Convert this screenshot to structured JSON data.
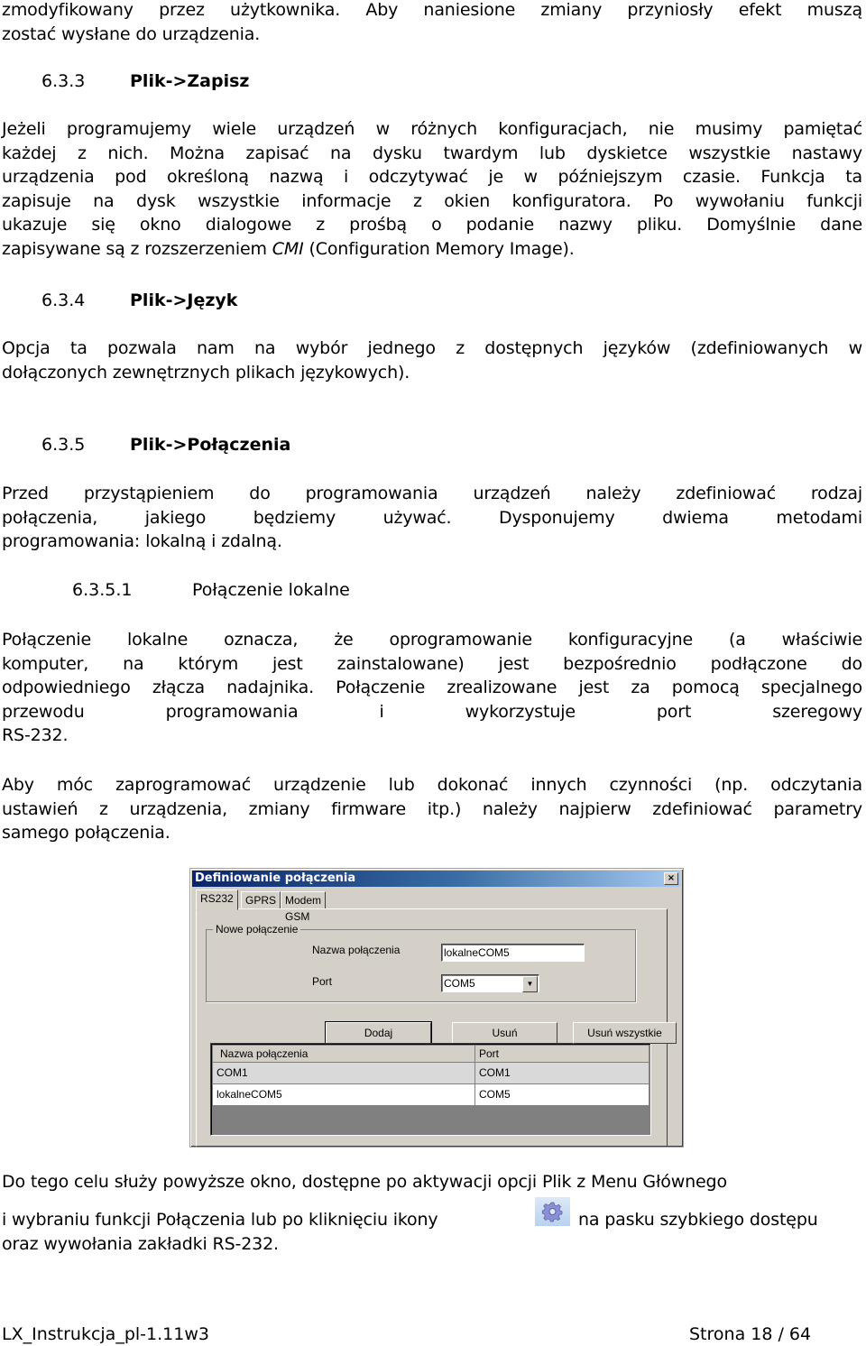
{
  "intro": {
    "lines": [
      "zmodyfikowany przez użytkownika. Aby naniesione zmiany przyniosły efekt muszą",
      "zostać wysłane do urządzenia."
    ]
  },
  "section_633": {
    "number": "6.3.3",
    "title": "Plik->Zapisz",
    "paragraph": [
      "Jeżeli programujemy wiele urządzeń w różnych konfiguracjach, nie musimy pamiętać",
      "każdej z nich. Można zapisać na dysku twardym lub dyskietce wszystkie nastawy",
      "urządzenia pod określoną nazwą i odczytywać je w późniejszym czasie. Funkcja ta",
      "zapisuje na dysk wszystkie informacje z okien konfiguratora. Po wywołaniu funkcji",
      "ukazuje się okno dialogowe z prośbą o podanie nazwy pliku.  Domyślnie dane"
    ],
    "last_line_before": "zapisywane są  z rozszerzeniem ",
    "last_line_italic": "CMI",
    "last_line_after": " (Configuration Memory Image)."
  },
  "section_634": {
    "number": "6.3.4",
    "title": "Plik->Język",
    "paragraph": [
      "Opcja ta pozwala nam na wybór jednego z dostępnych języków (zdefiniowanych w",
      "dołączonych zewnętrznych plikach językowych)."
    ]
  },
  "section_635": {
    "number": "6.3.5",
    "title": "Plik->Połączenia",
    "paragraph": [
      "Przed przystąpieniem do programowania urządzeń należy zdefiniować rodzaj",
      "połączenia, jakiego będziemy używać. Dysponujemy dwiema metodami",
      "programowania: lokalną i zdalną."
    ]
  },
  "section_6351": {
    "number": "6.3.5.1",
    "title": "Połączenie lokalne",
    "paragraph1": [
      "Połączenie lokalne oznacza, że oprogramowanie konfiguracyjne (a właściwie",
      "komputer, na którym jest zainstalowane) jest bezpośrednio podłączone do",
      "odpowiedniego złącza nadajnika. Połączenie zrealizowane jest za pomocą specjalnego",
      "przewodu programowania i wykorzystuje port szeregowy",
      "RS-232."
    ],
    "paragraph2": [
      "Aby móc zaprogramować urządzenie lub dokonać innych czynności (np. odczytania",
      "ustawień z urządzenia, zmiany firmware itp.) należy najpierw zdefiniować parametry",
      "samego połączenia."
    ]
  },
  "dialog": {
    "title": "Definiowanie połączenia",
    "close_glyph": "×",
    "tabs": [
      {
        "label": "RS232",
        "active": true
      },
      {
        "label": "GPRS",
        "active": false
      },
      {
        "label": "Modem GSM",
        "active": false
      }
    ],
    "group_label": "Nowe połączenie",
    "name_label": "Nazwa połączenia",
    "name_value": "lokalneCOM5",
    "port_label": "Port",
    "port_value": "COM5",
    "combo_arrow": "▼",
    "buttons": {
      "add": "Dodaj",
      "remove": "Usuń",
      "remove_all": "Usuń wszystkie"
    },
    "list": {
      "columns": [
        "Nazwa połączenia",
        "Port"
      ],
      "rows": [
        {
          "name": "COM1",
          "port": "COM1"
        },
        {
          "name": "lokalneCOM5",
          "port": "COM5"
        }
      ]
    }
  },
  "after_dialog": {
    "line1": "Do tego celu służy powyższe okno, dostępne po aktywacji opcji Plik z Menu Głównego",
    "line2_before": "i wybraniu funkcji Połączenia lub po kliknięciu ikony",
    "line2_after": "na pasku szybkiego dostępu",
    "line3": "oraz wywołania zakładki RS-232.",
    "icon": "gear-icon"
  },
  "footer": {
    "doc_name": "LX_Instrukcja_pl-1.11w3",
    "page": "Strona 18 / 64"
  }
}
